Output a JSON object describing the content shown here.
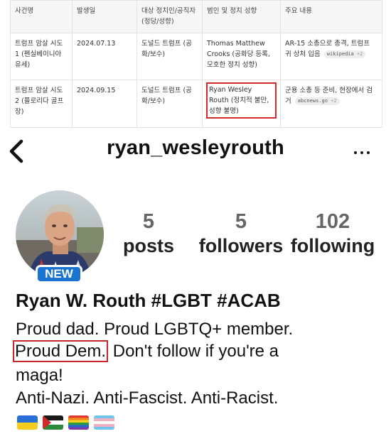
{
  "table": {
    "headers": [
      "사건명",
      "발생일",
      "대상 정치인/공직자 (정당/성향)",
      "범인 및 정치 성향",
      "주요 내용"
    ],
    "rows": [
      {
        "event": "트럼프 암살 시도 1 (펜실베이니아 유세)",
        "date": "2024.07.13",
        "target": "도널드 트럼프 (공화/보수)",
        "perpetrator": "Thomas Matthew Crooks (공화당 등록, 모호한 정치 성향)",
        "summary": "AR-15 소총으로 총격, 트럼프 귀 상처 입음",
        "source": "wikipedia",
        "source_more": "+2"
      },
      {
        "event": "트럼프 암살 시도 2 (플로리다 골프장)",
        "date": "2024.09.15",
        "target": "도널드 트럼프 (공화/보수)",
        "perpetrator": "Ryan Wesley Routh (정치적 불만, 성향 불명)",
        "summary": "군용 소총 등 준비, 현장에서 검거",
        "source": "abcnews.go",
        "source_more": "+2"
      }
    ]
  },
  "profile": {
    "back_icon": "chevron-left-icon",
    "username": "ryan_wesleyrouth",
    "more_icon": "more-horizontal-icon",
    "badge": "NEW",
    "stats": [
      {
        "value": "5",
        "label": "posts"
      },
      {
        "value": "5",
        "label": "followers"
      },
      {
        "value": "102",
        "label": "following"
      }
    ],
    "display_name": "Ryan W. Routh #LGBT #ACAB",
    "bio_line1": "Proud dad. Proud LGBTQ+ member.",
    "bio_line2_highlight": "Proud Dem.",
    "bio_line2_rest": " Don't follow if you're a",
    "bio_line3": "maga!",
    "bio_line4": "Anti-Nazi. Anti-Fascist. Anti-Racist.",
    "flags": [
      "ukraine-flag",
      "palestine-flag",
      "rainbow-flag",
      "transgender-flag"
    ],
    "highlight_color": "#c8262b",
    "badge_color": "#1a73d1"
  }
}
